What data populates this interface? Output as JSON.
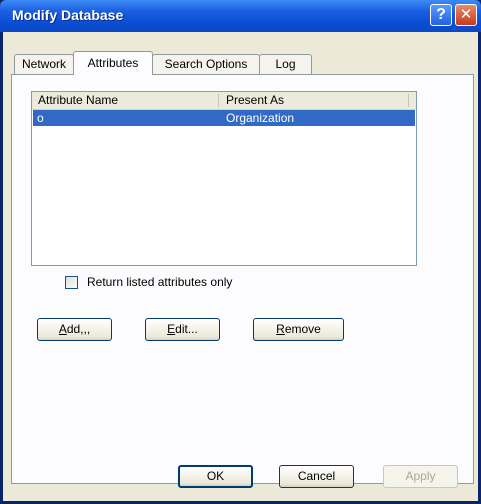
{
  "window": {
    "title": "Modify Database",
    "help_glyph": "?",
    "close_glyph": "✕"
  },
  "tabs": [
    {
      "label": "Network",
      "active": false
    },
    {
      "label": "Attributes",
      "active": true
    },
    {
      "label": "Search Options",
      "active": false
    },
    {
      "label": "Log",
      "active": false
    }
  ],
  "list": {
    "columns": [
      "Attribute Name",
      "Present As"
    ],
    "rows": [
      {
        "name": "o",
        "present_as": "Organization",
        "selected": true
      }
    ]
  },
  "checkbox": {
    "label": "Return listed attributes only",
    "checked": false
  },
  "actions": {
    "add": {
      "label": "Add...",
      "mnemonic": "A"
    },
    "edit": {
      "label": "Edit...",
      "mnemonic": "E"
    },
    "remove": {
      "label": "Remove",
      "mnemonic": "R"
    }
  },
  "footer": {
    "ok": "OK",
    "cancel": "Cancel",
    "apply": "Apply"
  },
  "colors": {
    "selection": "#316ac5",
    "titlebar": "#0a4fd6",
    "face": "#ece9d8"
  }
}
